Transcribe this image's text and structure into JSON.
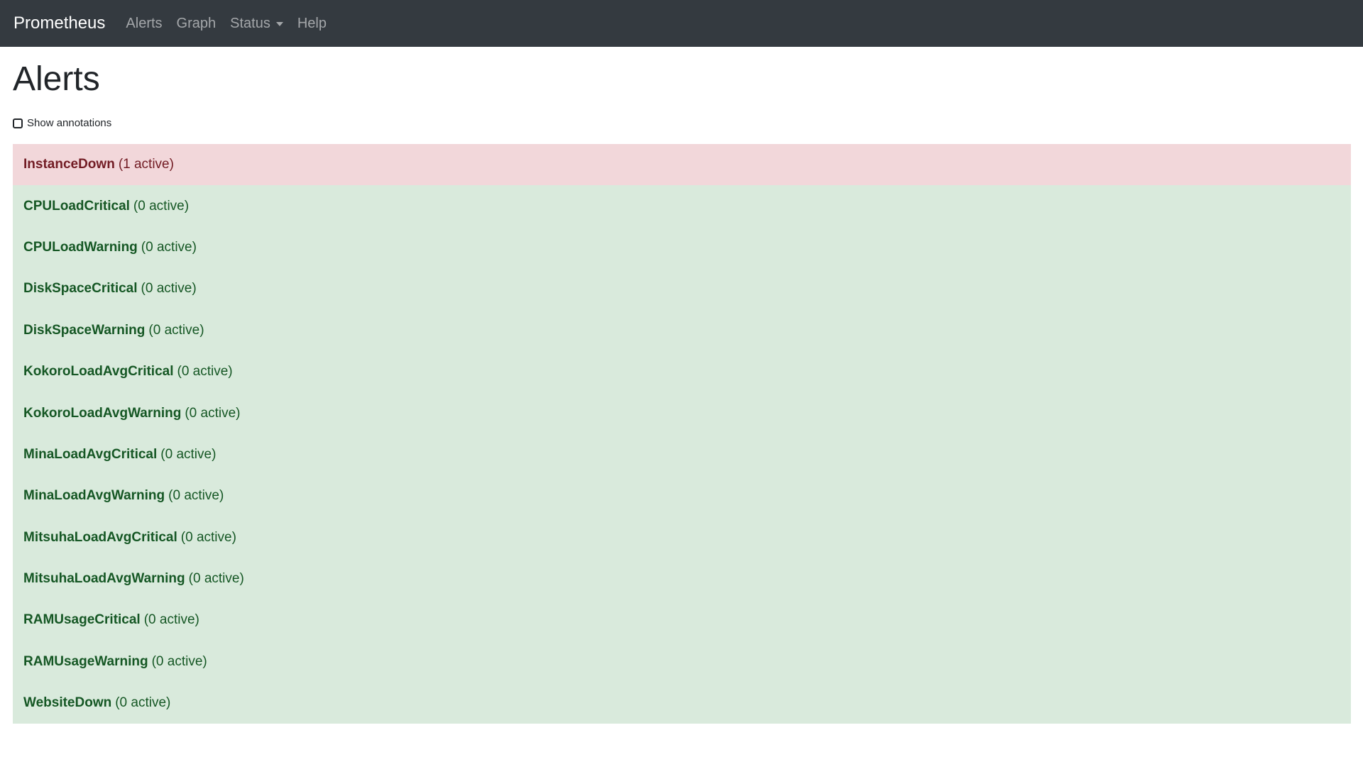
{
  "navbar": {
    "brand": "Prometheus",
    "links": [
      "Alerts",
      "Graph",
      "Status",
      "Help"
    ]
  },
  "page": {
    "title": "Alerts",
    "show_annotations_label": "Show annotations",
    "show_annotations_checked": false
  },
  "alerts": [
    {
      "name": "InstanceDown",
      "count": "(1 active)",
      "state": "firing"
    },
    {
      "name": "CPULoadCritical",
      "count": "(0 active)",
      "state": "inactive"
    },
    {
      "name": "CPULoadWarning",
      "count": "(0 active)",
      "state": "inactive"
    },
    {
      "name": "DiskSpaceCritical",
      "count": "(0 active)",
      "state": "inactive"
    },
    {
      "name": "DiskSpaceWarning",
      "count": "(0 active)",
      "state": "inactive"
    },
    {
      "name": "KokoroLoadAvgCritical",
      "count": "(0 active)",
      "state": "inactive"
    },
    {
      "name": "KokoroLoadAvgWarning",
      "count": "(0 active)",
      "state": "inactive"
    },
    {
      "name": "MinaLoadAvgCritical",
      "count": "(0 active)",
      "state": "inactive"
    },
    {
      "name": "MinaLoadAvgWarning",
      "count": "(0 active)",
      "state": "inactive"
    },
    {
      "name": "MitsuhaLoadAvgCritical",
      "count": "(0 active)",
      "state": "inactive"
    },
    {
      "name": "MitsuhaLoadAvgWarning",
      "count": "(0 active)",
      "state": "inactive"
    },
    {
      "name": "RAMUsageCritical",
      "count": "(0 active)",
      "state": "inactive"
    },
    {
      "name": "RAMUsageWarning",
      "count": "(0 active)",
      "state": "inactive"
    },
    {
      "name": "WebsiteDown",
      "count": "(0 active)",
      "state": "inactive"
    }
  ],
  "colors": {
    "navbar_bg": "#343a40",
    "firing_bg": "#f2d7da",
    "firing_text": "#721c24",
    "inactive_bg": "#d9eadc",
    "inactive_text": "#155724"
  },
  "icons": {
    "status_dropdown": "chevron-down-icon",
    "annotations_toggle": "checkbox-icon"
  }
}
